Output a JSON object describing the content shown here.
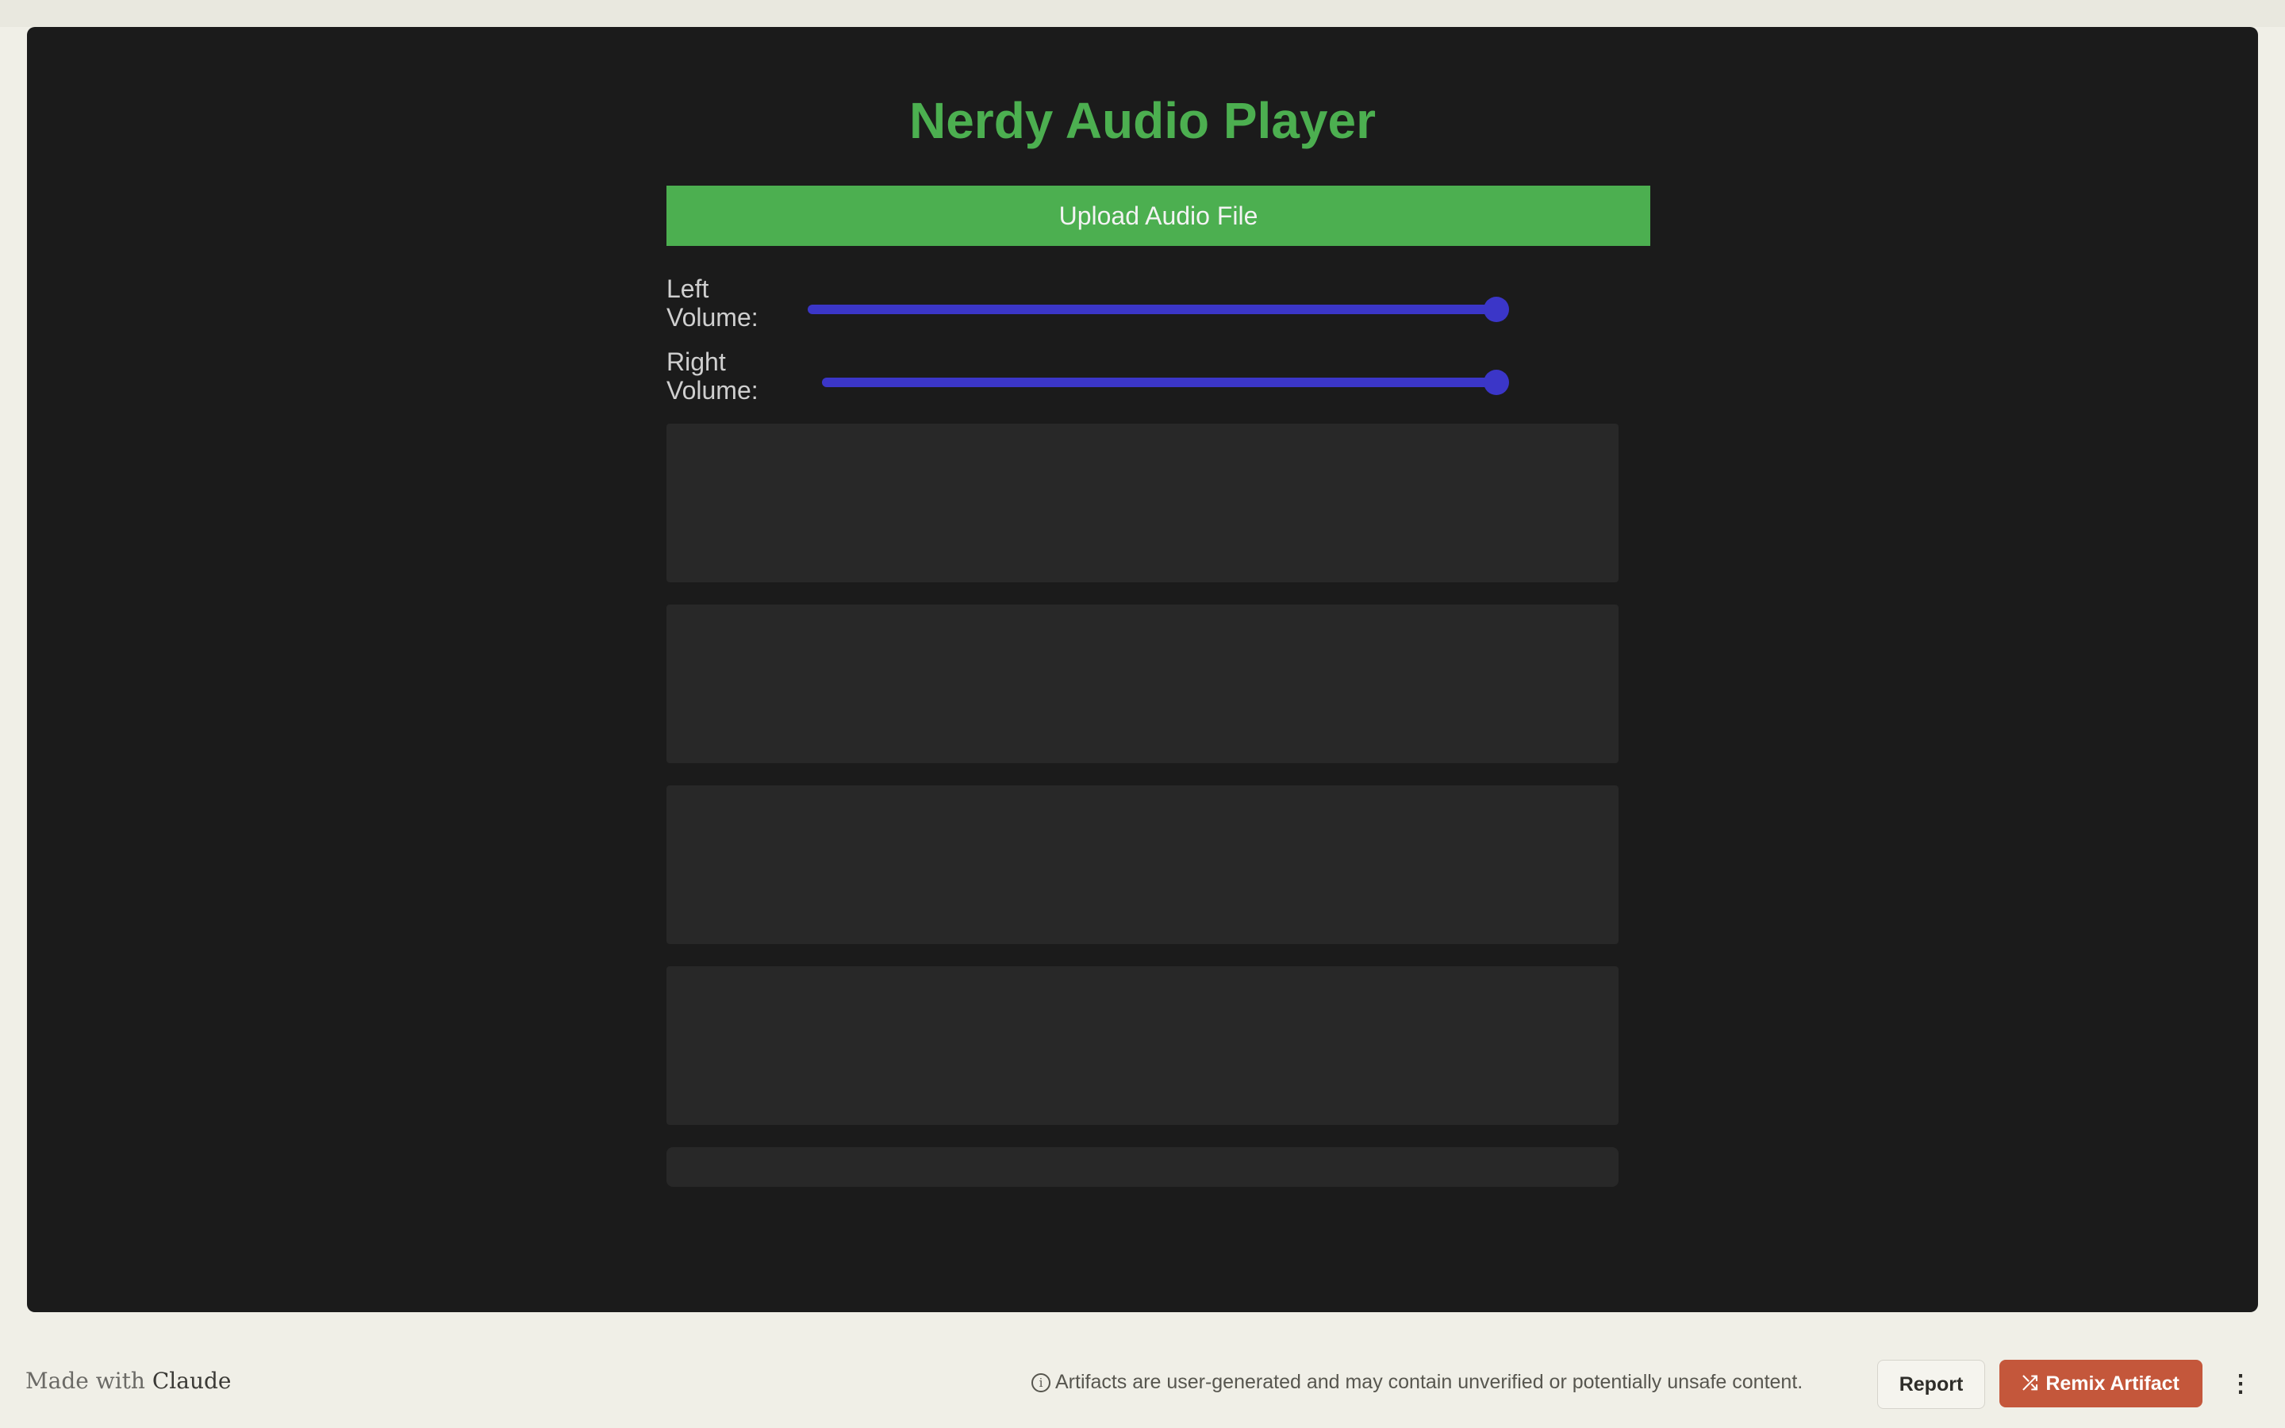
{
  "app": {
    "title": "Nerdy Audio Player",
    "upload_label": "Upload Audio File",
    "left_volume_label": "Left Volume:",
    "right_volume_label": "Right Volume:",
    "left_volume_value": 1.0,
    "right_volume_value": 1.0,
    "accent_color": "#4caf50",
    "slider_color": "#3b36c8"
  },
  "footer": {
    "made_with": "Made with",
    "brand": "Claude",
    "disclaimer": "Artifacts are user-generated and may contain unverified or potentially unsafe content.",
    "report_label": "Report",
    "remix_label": "Remix Artifact",
    "more_icon": "more-vertical-icon",
    "info_icon": "info-icon",
    "shuffle_icon": "shuffle-icon"
  }
}
